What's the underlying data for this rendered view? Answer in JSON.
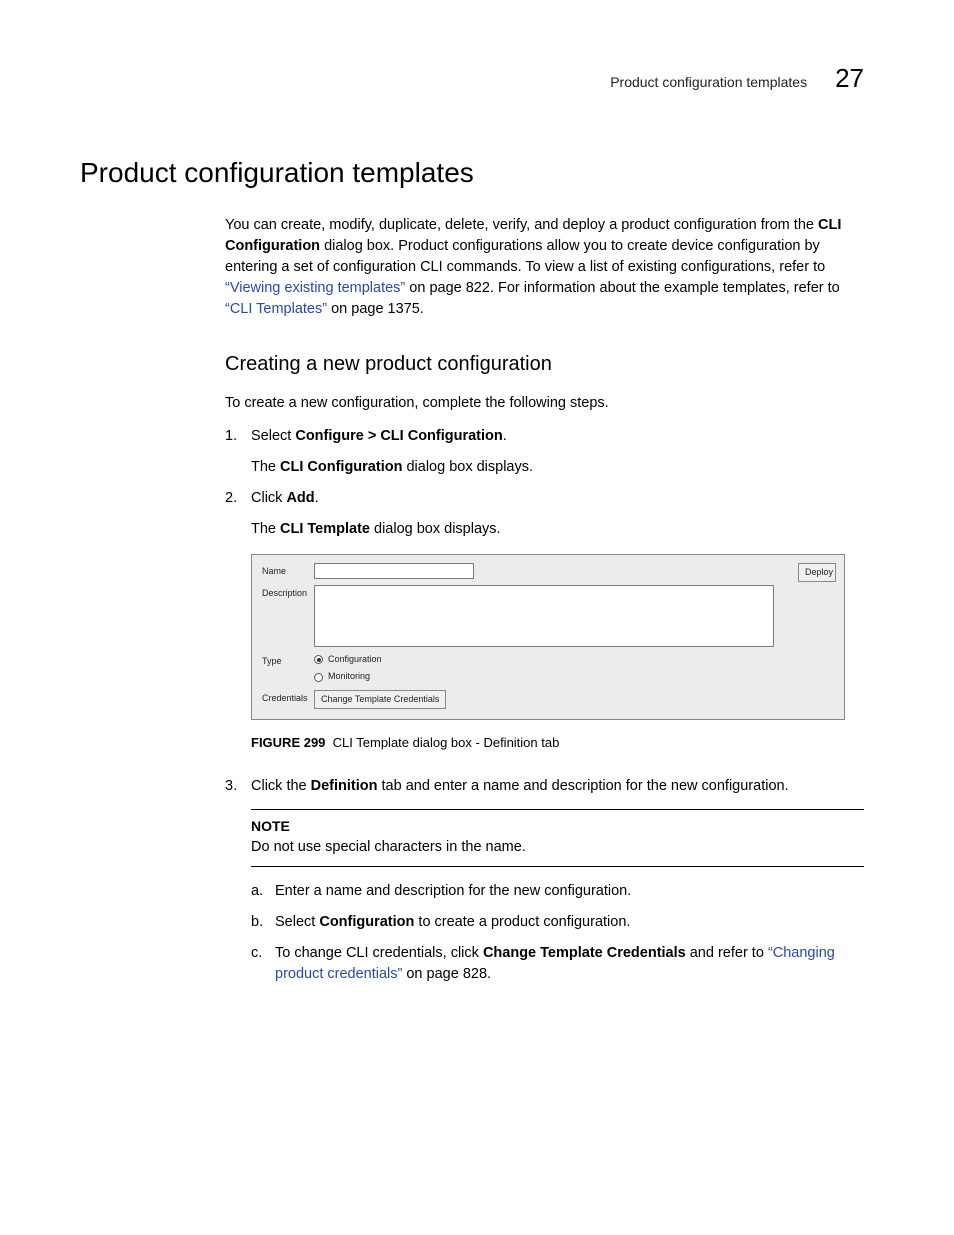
{
  "header": {
    "label": "Product configuration templates",
    "chapter": "27"
  },
  "title": "Product configuration templates",
  "intro": {
    "p1a": "You can create, modify, duplicate, delete, verify, and deploy a product configuration from the ",
    "p1b": "CLI Configuration",
    "p1c": " dialog box. Product configurations allow you to create device configuration by entering a set of configuration CLI commands. To view a list of existing configurations, refer to ",
    "link1": "“Viewing existing templates”",
    "p1d": " on page 822. For information about the example templates, refer to ",
    "link2": "“CLI Templates”",
    "p1e": " on page 1375."
  },
  "subhead": "Creating a new product configuration",
  "lead": "To create a new configuration, complete the following steps.",
  "steps": {
    "s1": {
      "num": "1.",
      "pre": "Select ",
      "bold": "Configure > CLI Configuration",
      "post": ".",
      "sub_pre": "The ",
      "sub_bold": "CLI Configuration",
      "sub_post": " dialog box displays."
    },
    "s2": {
      "num": "2.",
      "pre": "Click ",
      "bold": "Add",
      "post": ".",
      "sub_pre": "The ",
      "sub_bold": "CLI Template",
      "sub_post": " dialog box displays."
    },
    "s3": {
      "num": "3.",
      "pre": "Click the ",
      "bold": "Definition",
      "post": " tab and enter a name and description for the new configuration."
    }
  },
  "dialog": {
    "name_label": "Name",
    "desc_label": "Description",
    "type_label": "Type",
    "radio_config": "Configuration",
    "radio_monitor": "Monitoring",
    "cred_label": "Credentials",
    "cred_btn": "Change Template Credentials",
    "deploy_btn": "Deploy"
  },
  "figcaption": {
    "bold": "FIGURE 299",
    "text": "CLI Template dialog box - Definition tab"
  },
  "note": {
    "title": "NOTE",
    "text": "Do not use special characters in the name."
  },
  "sublist": {
    "a": {
      "num": "a.",
      "text": "Enter a name and description for the new configuration."
    },
    "b": {
      "num": "b.",
      "pre": "Select ",
      "bold": "Configuration",
      "post": " to create a product configuration."
    },
    "c": {
      "num": "c.",
      "pre": "To change CLI credentials, click ",
      "bold": "Change Template Credentials",
      "mid": " and refer to ",
      "link": "“Changing product credentials”",
      "post": " on page 828."
    }
  }
}
